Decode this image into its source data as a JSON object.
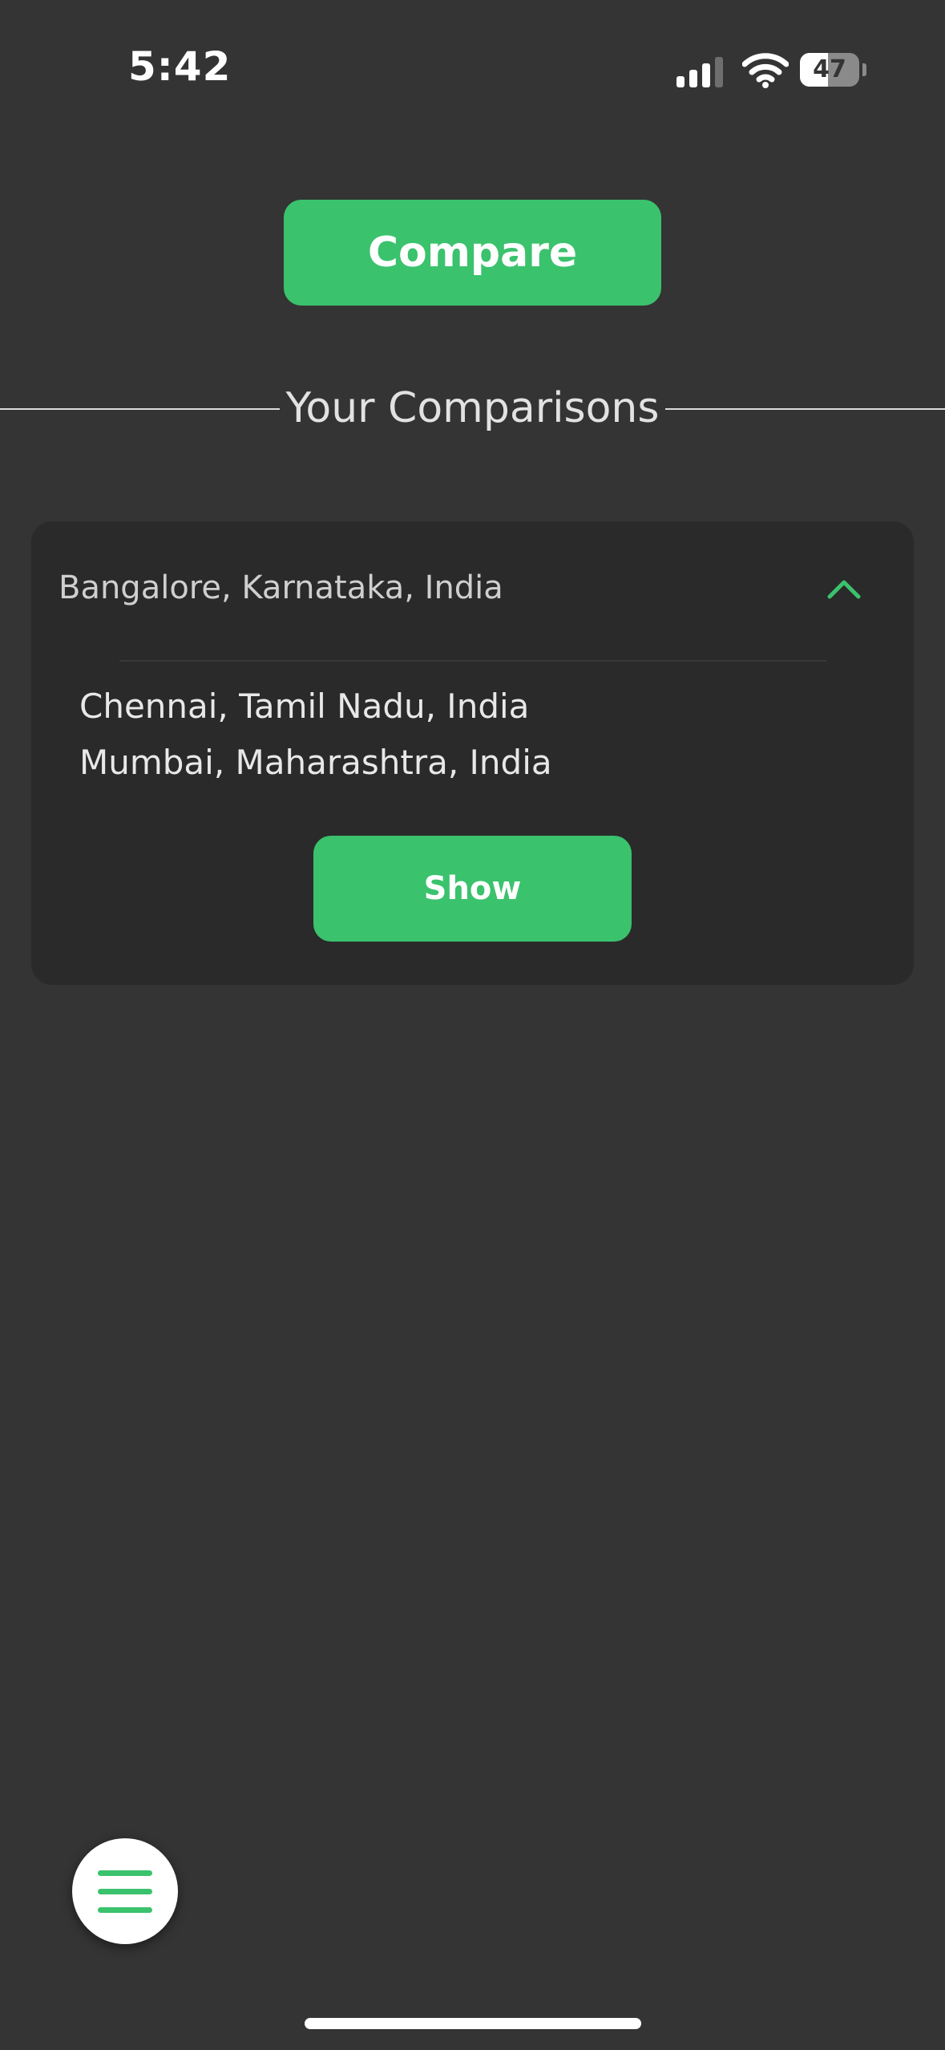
{
  "status_bar": {
    "time": "5:42",
    "battery_level": "47",
    "battery_fraction": 0.47,
    "icons": [
      "cellular-signal-icon",
      "wifi-icon",
      "battery-icon"
    ]
  },
  "actions": {
    "compare_label": "Compare"
  },
  "section": {
    "title": "Your Comparisons"
  },
  "comparisons": [
    {
      "base_city": "Bangalore, Karnataka, India",
      "expanded": true,
      "compared_cities": [
        "Chennai, Tamil Nadu, India",
        "Mumbai, Maharashtra, India"
      ],
      "show_label": "Show"
    }
  ],
  "menu": {
    "icon": "hamburger-menu-icon"
  },
  "colors": {
    "accent": "#3bc26d",
    "background": "#343434",
    "card": "#2a2a2a"
  }
}
